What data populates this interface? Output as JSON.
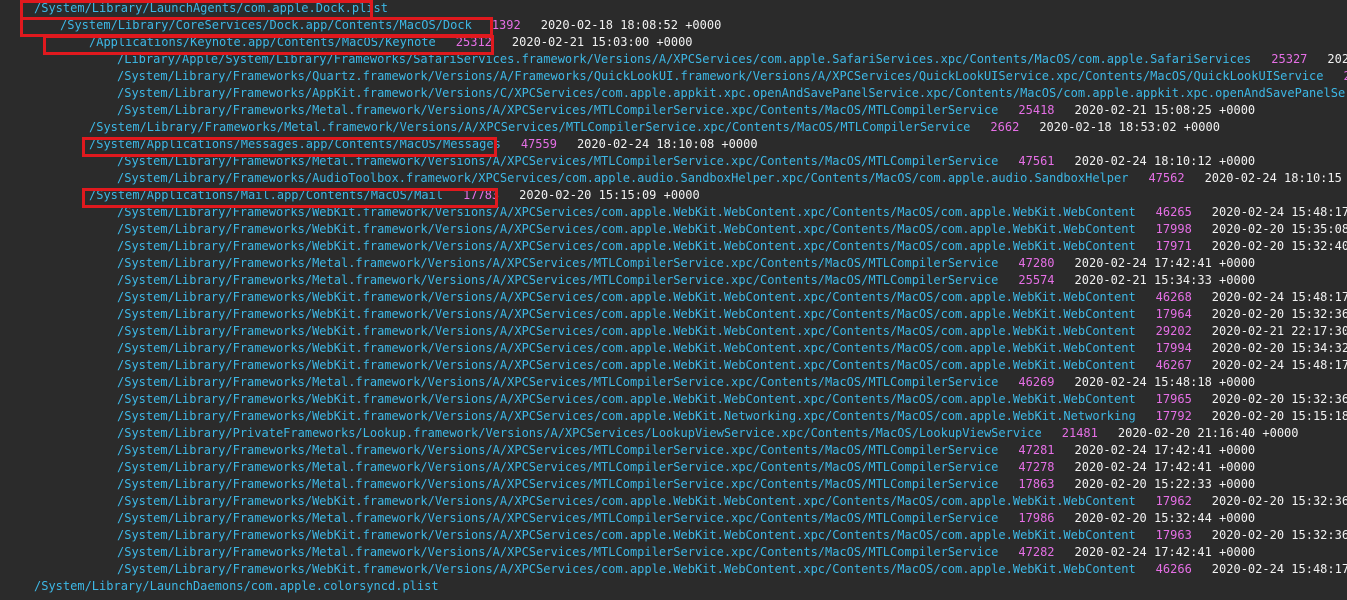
{
  "colors": {
    "background": "#2b2b2b",
    "path": "#3db8e6",
    "pid": "#e66fe6",
    "timestamp": "#f2f2f2",
    "highlight": "#e0191e"
  },
  "rows": [
    {
      "depth": 0,
      "path": "/System/Library/LaunchAgents/com.apple.Dock.plist",
      "pid": "",
      "time": ""
    },
    {
      "depth": 1,
      "path": "/System/Library/CoreServices/Dock.app/Contents/MacOS/Dock",
      "pid": "1392",
      "time": "2020-02-18 18:08:52 +0000"
    },
    {
      "depth": 2,
      "path": "/Applications/Keynote.app/Contents/MacOS/Keynote",
      "pid": "25312",
      "time": "2020-02-21 15:03:00 +0000"
    },
    {
      "depth": 3,
      "path": "/Library/Apple/System/Library/Frameworks/SafariServices.framework/Versions/A/XPCServices/com.apple.SafariServices.xpc/Contents/MacOS/com.apple.SafariServices",
      "pid": "25327",
      "time": "2020-02-"
    },
    {
      "depth": 3,
      "path": "/System/Library/Frameworks/Quartz.framework/Versions/A/Frameworks/QuickLookUI.framework/Versions/A/XPCServices/QuickLookUIService.xpc/Contents/MacOS/QuickLookUIService",
      "pid": "25314",
      "time": ""
    },
    {
      "depth": 3,
      "path": "/System/Library/Frameworks/AppKit.framework/Versions/C/XPCServices/com.apple.appkit.xpc.openAndSavePanelService.xpc/Contents/MacOS/com.apple.appkit.xpc.openAndSavePanelService",
      "pid": "",
      "time": ""
    },
    {
      "depth": 3,
      "path": "/System/Library/Frameworks/Metal.framework/Versions/A/XPCServices/MTLCompilerService.xpc/Contents/MacOS/MTLCompilerService",
      "pid": "25418",
      "time": "2020-02-21 15:08:25 +0000"
    },
    {
      "depth": 2,
      "path": "/System/Library/Frameworks/Metal.framework/Versions/A/XPCServices/MTLCompilerService.xpc/Contents/MacOS/MTLCompilerService",
      "pid": "2662",
      "time": "2020-02-18 18:53:02 +0000"
    },
    {
      "depth": 2,
      "path": "/System/Applications/Messages.app/Contents/MacOS/Messages",
      "pid": "47559",
      "time": "2020-02-24 18:10:08 +0000"
    },
    {
      "depth": 3,
      "path": "/System/Library/Frameworks/Metal.framework/Versions/A/XPCServices/MTLCompilerService.xpc/Contents/MacOS/MTLCompilerService",
      "pid": "47561",
      "time": "2020-02-24 18:10:12 +0000"
    },
    {
      "depth": 3,
      "path": "/System/Library/Frameworks/AudioToolbox.framework/XPCServices/com.apple.audio.SandboxHelper.xpc/Contents/MacOS/com.apple.audio.SandboxHelper",
      "pid": "47562",
      "time": "2020-02-24 18:10:15 +0000"
    },
    {
      "depth": 2,
      "path": "/System/Applications/Mail.app/Contents/MacOS/Mail",
      "pid": "17783",
      "time": "2020-02-20 15:15:09 +0000"
    },
    {
      "depth": 3,
      "path": "/System/Library/Frameworks/WebKit.framework/Versions/A/XPCServices/com.apple.WebKit.WebContent.xpc/Contents/MacOS/com.apple.WebKit.WebContent",
      "pid": "46265",
      "time": "2020-02-24 15:48:17 +000"
    },
    {
      "depth": 3,
      "path": "/System/Library/Frameworks/WebKit.framework/Versions/A/XPCServices/com.apple.WebKit.WebContent.xpc/Contents/MacOS/com.apple.WebKit.WebContent",
      "pid": "17998",
      "time": "2020-02-20 15:35:08 +000"
    },
    {
      "depth": 3,
      "path": "/System/Library/Frameworks/WebKit.framework/Versions/A/XPCServices/com.apple.WebKit.WebContent.xpc/Contents/MacOS/com.apple.WebKit.WebContent",
      "pid": "17971",
      "time": "2020-02-20 15:32:40 +000"
    },
    {
      "depth": 3,
      "path": "/System/Library/Frameworks/Metal.framework/Versions/A/XPCServices/MTLCompilerService.xpc/Contents/MacOS/MTLCompilerService",
      "pid": "47280",
      "time": "2020-02-24 17:42:41 +0000"
    },
    {
      "depth": 3,
      "path": "/System/Library/Frameworks/Metal.framework/Versions/A/XPCServices/MTLCompilerService.xpc/Contents/MacOS/MTLCompilerService",
      "pid": "25574",
      "time": "2020-02-21 15:34:33 +0000"
    },
    {
      "depth": 3,
      "path": "/System/Library/Frameworks/WebKit.framework/Versions/A/XPCServices/com.apple.WebKit.WebContent.xpc/Contents/MacOS/com.apple.WebKit.WebContent",
      "pid": "46268",
      "time": "2020-02-24 15:48:17 +000"
    },
    {
      "depth": 3,
      "path": "/System/Library/Frameworks/WebKit.framework/Versions/A/XPCServices/com.apple.WebKit.WebContent.xpc/Contents/MacOS/com.apple.WebKit.WebContent",
      "pid": "17964",
      "time": "2020-02-20 15:32:36 +000"
    },
    {
      "depth": 3,
      "path": "/System/Library/Frameworks/WebKit.framework/Versions/A/XPCServices/com.apple.WebKit.WebContent.xpc/Contents/MacOS/com.apple.WebKit.WebContent",
      "pid": "29202",
      "time": "2020-02-21 22:17:30 +000"
    },
    {
      "depth": 3,
      "path": "/System/Library/Frameworks/WebKit.framework/Versions/A/XPCServices/com.apple.WebKit.WebContent.xpc/Contents/MacOS/com.apple.WebKit.WebContent",
      "pid": "17994",
      "time": "2020-02-20 15:34:32 +000"
    },
    {
      "depth": 3,
      "path": "/System/Library/Frameworks/WebKit.framework/Versions/A/XPCServices/com.apple.WebKit.WebContent.xpc/Contents/MacOS/com.apple.WebKit.WebContent",
      "pid": "46267",
      "time": "2020-02-24 15:48:17 +000"
    },
    {
      "depth": 3,
      "path": "/System/Library/Frameworks/Metal.framework/Versions/A/XPCServices/MTLCompilerService.xpc/Contents/MacOS/MTLCompilerService",
      "pid": "46269",
      "time": "2020-02-24 15:48:18 +0000"
    },
    {
      "depth": 3,
      "path": "/System/Library/Frameworks/WebKit.framework/Versions/A/XPCServices/com.apple.WebKit.WebContent.xpc/Contents/MacOS/com.apple.WebKit.WebContent",
      "pid": "17965",
      "time": "2020-02-20 15:32:36 +000"
    },
    {
      "depth": 3,
      "path": "/System/Library/Frameworks/WebKit.framework/Versions/A/XPCServices/com.apple.WebKit.Networking.xpc/Contents/MacOS/com.apple.WebKit.Networking",
      "pid": "17792",
      "time": "2020-02-20 15:15:18 +000"
    },
    {
      "depth": 3,
      "path": "/System/Library/PrivateFrameworks/Lookup.framework/Versions/A/XPCServices/LookupViewService.xpc/Contents/MacOS/LookupViewService",
      "pid": "21481",
      "time": "2020-02-20 21:16:40 +0000"
    },
    {
      "depth": 3,
      "path": "/System/Library/Frameworks/Metal.framework/Versions/A/XPCServices/MTLCompilerService.xpc/Contents/MacOS/MTLCompilerService",
      "pid": "47281",
      "time": "2020-02-24 17:42:41 +0000"
    },
    {
      "depth": 3,
      "path": "/System/Library/Frameworks/Metal.framework/Versions/A/XPCServices/MTLCompilerService.xpc/Contents/MacOS/MTLCompilerService",
      "pid": "47278",
      "time": "2020-02-24 17:42:41 +0000"
    },
    {
      "depth": 3,
      "path": "/System/Library/Frameworks/Metal.framework/Versions/A/XPCServices/MTLCompilerService.xpc/Contents/MacOS/MTLCompilerService",
      "pid": "17863",
      "time": "2020-02-20 15:22:33 +0000"
    },
    {
      "depth": 3,
      "path": "/System/Library/Frameworks/WebKit.framework/Versions/A/XPCServices/com.apple.WebKit.WebContent.xpc/Contents/MacOS/com.apple.WebKit.WebContent",
      "pid": "17962",
      "time": "2020-02-20 15:32:36 +000"
    },
    {
      "depth": 3,
      "path": "/System/Library/Frameworks/Metal.framework/Versions/A/XPCServices/MTLCompilerService.xpc/Contents/MacOS/MTLCompilerService",
      "pid": "17986",
      "time": "2020-02-20 15:32:44 +0000"
    },
    {
      "depth": 3,
      "path": "/System/Library/Frameworks/WebKit.framework/Versions/A/XPCServices/com.apple.WebKit.WebContent.xpc/Contents/MacOS/com.apple.WebKit.WebContent",
      "pid": "17963",
      "time": "2020-02-20 15:32:36 +000"
    },
    {
      "depth": 3,
      "path": "/System/Library/Frameworks/Metal.framework/Versions/A/XPCServices/MTLCompilerService.xpc/Contents/MacOS/MTLCompilerService",
      "pid": "47282",
      "time": "2020-02-24 17:42:41 +0000"
    },
    {
      "depth": 3,
      "path": "/System/Library/Frameworks/WebKit.framework/Versions/A/XPCServices/com.apple.WebKit.WebContent.xpc/Contents/MacOS/com.apple.WebKit.WebContent",
      "pid": "46266",
      "time": "2020-02-24 15:48:17 +000"
    },
    {
      "depth": 0,
      "path": "/System/Library/LaunchDaemons/com.apple.colorsyncd.plist",
      "pid": "",
      "time": ""
    }
  ]
}
